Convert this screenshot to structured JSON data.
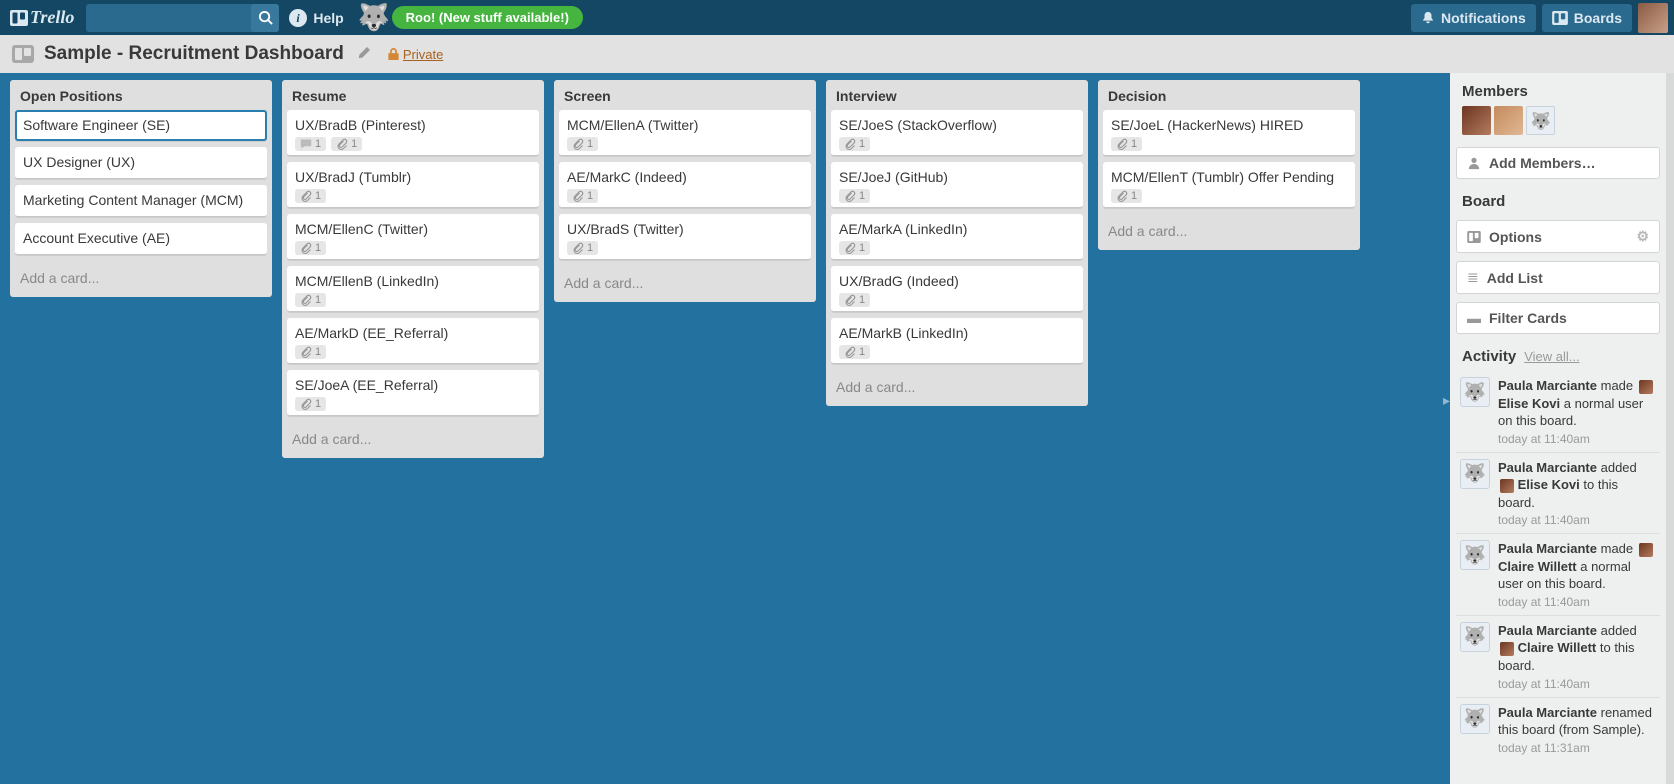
{
  "header": {
    "logo_text": "Trello",
    "help_label": "Help",
    "roo_label": "Roo! (New stuff available!)",
    "notifications_label": "Notifications",
    "boards_label": "Boards"
  },
  "board": {
    "title": "Sample - Recruitment Dashboard",
    "privacy_label": "Private"
  },
  "lists": [
    {
      "name": "Open Positions",
      "cards": [
        {
          "title": "Software Engineer (SE)",
          "selected": true
        },
        {
          "title": "UX Designer (UX)"
        },
        {
          "title": "Marketing Content Manager (MCM)"
        },
        {
          "title": "Account Executive (AE)"
        }
      ]
    },
    {
      "name": "Resume",
      "cards": [
        {
          "title": "UX/BradB (Pinterest)",
          "comments": 1,
          "attachments": 1
        },
        {
          "title": "UX/BradJ (Tumblr)",
          "attachments": 1
        },
        {
          "title": "MCM/EllenC (Twitter)",
          "attachments": 1
        },
        {
          "title": "MCM/EllenB (LinkedIn)",
          "attachments": 1
        },
        {
          "title": "AE/MarkD (EE_Referral)",
          "attachments": 1
        },
        {
          "title": "SE/JoeA (EE_Referral)",
          "attachments": 1
        }
      ]
    },
    {
      "name": "Screen",
      "cards": [
        {
          "title": "MCM/EllenA (Twitter)",
          "attachments": 1
        },
        {
          "title": "AE/MarkC (Indeed)",
          "attachments": 1
        },
        {
          "title": "UX/BradS (Twitter)",
          "attachments": 1
        }
      ]
    },
    {
      "name": "Interview",
      "cards": [
        {
          "title": "SE/JoeS (StackOverflow)",
          "attachments": 1
        },
        {
          "title": "SE/JoeJ (GitHub)",
          "attachments": 1
        },
        {
          "title": "AE/MarkA (LinkedIn)",
          "attachments": 1
        },
        {
          "title": "UX/BradG (Indeed)",
          "attachments": 1
        },
        {
          "title": "AE/MarkB (LinkedIn)",
          "attachments": 1
        }
      ]
    },
    {
      "name": "Decision",
      "cards": [
        {
          "title": "SE/JoeL (HackerNews) HIRED",
          "attachments": 1
        },
        {
          "title": "MCM/EllenT (Tumblr) Offer Pending",
          "attachments": 1
        }
      ]
    }
  ],
  "add_card_label": "Add a card...",
  "sidebar": {
    "members_heading": "Members",
    "add_members_label": "Add Members…",
    "board_heading": "Board",
    "options_label": "Options",
    "add_list_label": "Add List",
    "filter_cards_label": "Filter Cards",
    "activity_heading": "Activity",
    "view_all_label": "View all...",
    "activity": [
      {
        "actor": "Paula Marciante",
        "verb": "made",
        "target": "Elise Kovi",
        "rest": "a normal user on this board.",
        "show_avatar": true,
        "ts": "today at 11:40am"
      },
      {
        "actor": "Paula Marciante",
        "verb": "added",
        "target": "Elise Kovi",
        "rest": "to this board.",
        "show_avatar": true,
        "ts": "today at 11:40am"
      },
      {
        "actor": "Paula Marciante",
        "verb": "made",
        "target": "Claire Willett",
        "rest": "a normal user on this board.",
        "show_avatar": true,
        "ts": "today at 11:40am"
      },
      {
        "actor": "Paula Marciante",
        "verb": "added",
        "target": "Claire Willett",
        "rest": "to this board.",
        "show_avatar": true,
        "ts": "today at 11:40am"
      },
      {
        "actor": "Paula Marciante",
        "verb": "renamed this board (from Sample).",
        "target": "",
        "rest": "",
        "show_avatar": false,
        "ts": "today at 11:31am"
      }
    ]
  }
}
